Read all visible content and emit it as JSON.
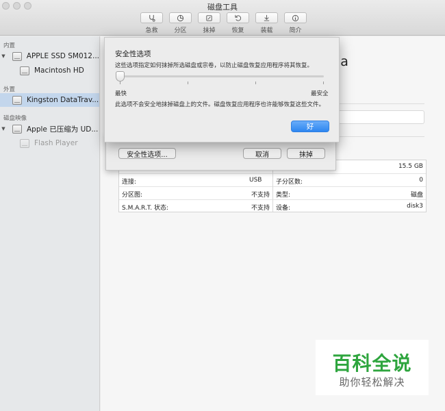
{
  "window": {
    "title": "磁盘工具"
  },
  "toolbar": {
    "items": [
      {
        "label": "急救",
        "icon": "stethoscope-icon"
      },
      {
        "label": "分区",
        "icon": "partition-pie-icon"
      },
      {
        "label": "抹掉",
        "icon": "erase-icon"
      },
      {
        "label": "恢复",
        "icon": "restore-icon"
      },
      {
        "label": "装载",
        "icon": "mount-icon"
      },
      {
        "label": "简介",
        "icon": "info-icon"
      }
    ]
  },
  "sidebar": {
    "sections": {
      "internal": "内置",
      "external": "外置",
      "images": "磁盘映像"
    },
    "items": {
      "apple_ssd": "APPLE SSD SM012...",
      "macintosh_hd": "Macintosh HD",
      "kingston": "Kingston DataTrav...",
      "apple_compressed": "Apple 已压缩为 UD...",
      "flash_player": "Flash Player"
    },
    "selected_color": "#c3d6ec"
  },
  "main": {
    "title_fragment": "ia",
    "info": {
      "capacity_value": "15.5 GB",
      "connection_label": "连接:",
      "connection_value": "USB",
      "partition_map_label": "分区图:",
      "partition_map_value": "不支持",
      "smart_label": "S.M.A.R.T. 状态:",
      "smart_value": "不支持",
      "child_count_label": "子分区数:",
      "child_count_value": "0",
      "type_label": "类型:",
      "type_value": "磁盘",
      "device_label": "设备:",
      "device_value": "disk3"
    }
  },
  "erase_sheet": {
    "security_options_button": "安全性选项...",
    "cancel_button": "取消",
    "erase_button": "抹掉"
  },
  "security_dialog": {
    "title": "安全性选项",
    "description": "这些选项指定如何抹掉所选磁盘或宗卷，以防止磁盘恢复应用程序将其恢复。",
    "slider_min_label": "最快",
    "slider_max_label": "最安全",
    "slider_level": 0,
    "note": "此选项不会安全地抹掉磁盘上的文件。磁盘恢复应用程序也许能够恢复这些文件。",
    "ok_button": "好",
    "accent_color": "#2d86f0"
  },
  "watermark": {
    "main": "百科全说",
    "sub": "助你轻松解决",
    "color": "#2ea53e"
  }
}
